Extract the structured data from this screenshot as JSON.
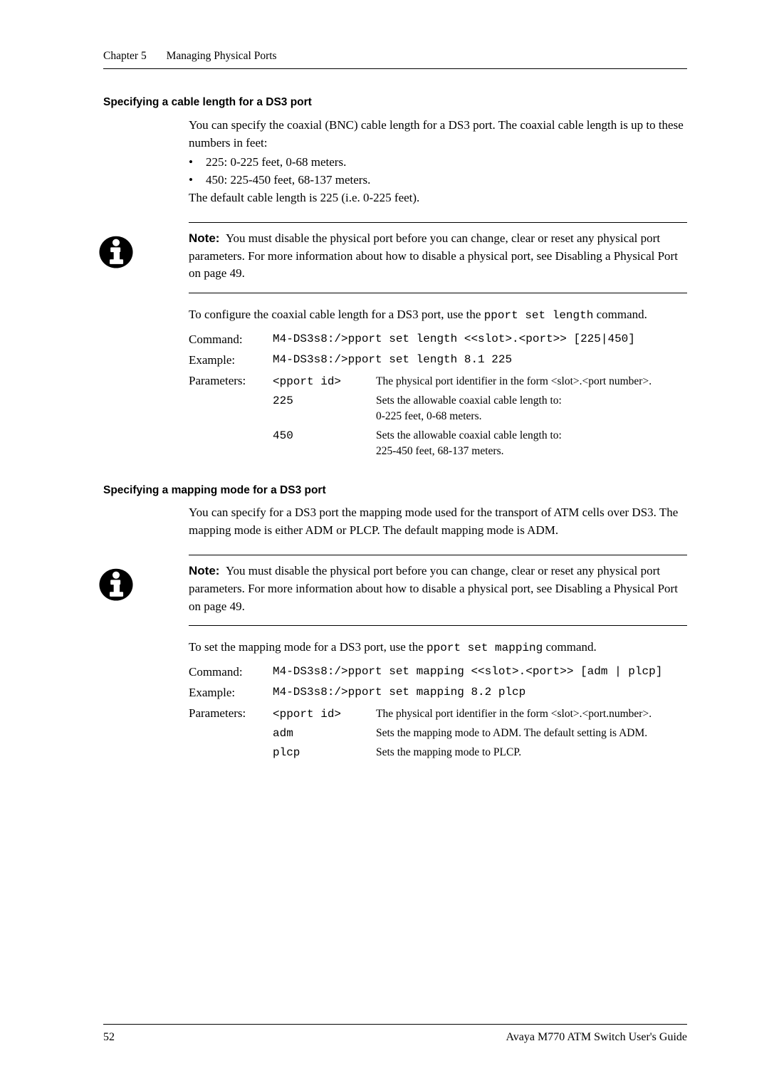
{
  "header": {
    "chapter": "Chapter 5",
    "title": "Managing Physical Ports"
  },
  "section1": {
    "heading": "Specifying a cable length for a DS3 port",
    "p1": "You can specify the coaxial (BNC) cable length for a DS3 port. The coaxial cable length is up to these numbers in feet:",
    "b1": "225: 0-225 feet, 0-68 meters.",
    "b2": "450: 225-450 feet, 68-137 meters.",
    "p2": "The default cable length is 225 (i.e. 0-225 feet).",
    "note_label": "Note:",
    "note_body": "You must disable the physical port before you can change, clear or reset any physical port parameters. For more information about how to disable a physical port, see Disabling a Physical Port on page 49.",
    "p3a": "To configure the coaxial cable length for a DS3 port, use the ",
    "p3code": "pport set length",
    "p3b": " command.",
    "cmd_label": "Command:",
    "cmd_value": "M4-DS3s8:/>pport set length <<slot>.<port>> [225|450]",
    "ex_label": "Example:",
    "ex_value": "M4-DS3s8:/>pport set length 8.1 225",
    "params_label": "Parameters:",
    "param1_name": "<pport id>",
    "param1_desc": "The physical port identifier in the form <slot>.<port number>.",
    "param2_name": "225",
    "param2_desc_l1": "Sets the allowable coaxial cable length to:",
    "param2_desc_l2": "0-225 feet, 0-68 meters.",
    "param3_name": "450",
    "param3_desc_l1": "Sets the allowable coaxial cable length to:",
    "param3_desc_l2": "225-450 feet, 68-137 meters."
  },
  "section2": {
    "heading": "Specifying a mapping mode for a DS3  port",
    "p1": "You can specify for a DS3 port the mapping mode used for the transport of ATM cells over DS3. The mapping mode is either ADM or PLCP. The default mapping mode is ADM.",
    "note_label": "Note:",
    "note_body": "You must disable the physical port before you can change, clear or reset any physical port parameters. For more information about how to disable a physical port, see Disabling a Physical Port on page 49.",
    "p2a": "To set the mapping mode for a DS3 port, use the ",
    "p2code": "pport set mapping",
    "p2b": " command.",
    "cmd_label": "Command:",
    "cmd_value": "M4-DS3s8:/>pport set mapping <<slot>.<port>> [adm | plcp]",
    "ex_label": "Example:",
    "ex_value": "M4-DS3s8:/>pport set mapping 8.2 plcp",
    "params_label": "Parameters:",
    "param1_name": "<pport id>",
    "param1_desc": "The physical port identifier in the form <slot>.<port.number>.",
    "param2_name": "adm",
    "param2_desc": "Sets the mapping mode to ADM. The default setting is ADM.",
    "param3_name": "plcp",
    "param3_desc": "Sets the mapping mode to PLCP."
  },
  "footer": {
    "page": "52",
    "guide": "Avaya M770 ATM Switch User's Guide"
  }
}
